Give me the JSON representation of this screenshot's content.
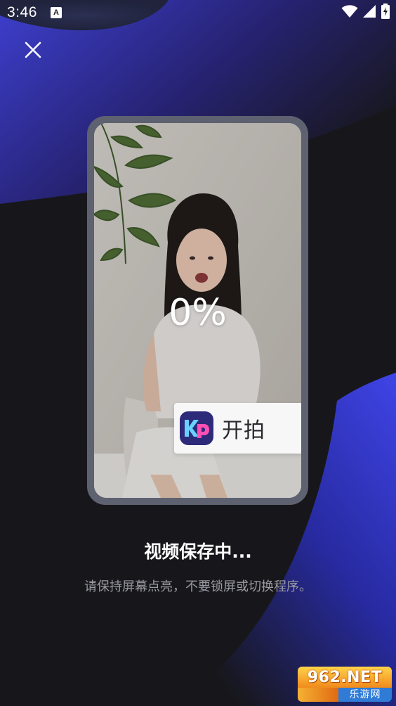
{
  "status_bar": {
    "time": "3:46",
    "notification_badge": "A",
    "icons": [
      "wifi-icon",
      "signal-icon",
      "battery-charging-icon"
    ]
  },
  "toolbar": {
    "close_icon": "close-icon"
  },
  "preview": {
    "progress_label": "0%",
    "progress_value": 0,
    "brand_name": "开拍",
    "logo_icon": "kp-logo-icon"
  },
  "status": {
    "title": "视频保存中...",
    "hint": "请保持屏幕点亮，不要锁屏或切换程序。"
  },
  "watermark": {
    "site": "962.NET",
    "subtitle": "乐游网"
  },
  "colors": {
    "background": "#17171b",
    "accent_blue": "#3a3ed8",
    "frame": "#5d6170",
    "text_primary": "#ffffff",
    "text_secondary": "#9a9ba3"
  }
}
